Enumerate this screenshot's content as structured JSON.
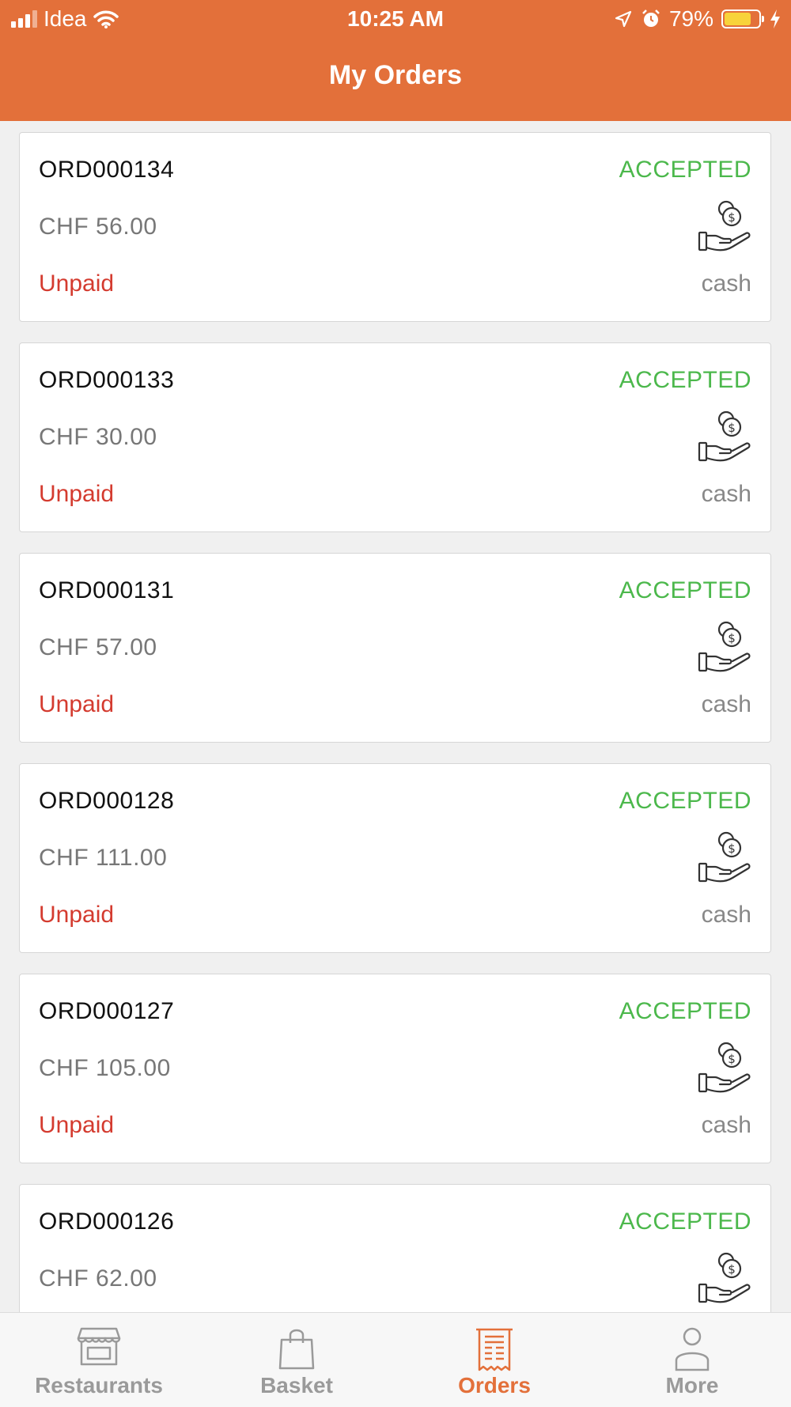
{
  "status_bar": {
    "carrier": "Idea",
    "time": "10:25 AM",
    "battery": "79%",
    "battery_level": 0.79
  },
  "header": {
    "title": "My Orders"
  },
  "orders": [
    {
      "id": "ORD000134",
      "status": "ACCEPTED",
      "amount": "CHF 56.00",
      "payment_status": "Unpaid",
      "payment_method": "cash"
    },
    {
      "id": "ORD000133",
      "status": "ACCEPTED",
      "amount": "CHF 30.00",
      "payment_status": "Unpaid",
      "payment_method": "cash"
    },
    {
      "id": "ORD000131",
      "status": "ACCEPTED",
      "amount": "CHF 57.00",
      "payment_status": "Unpaid",
      "payment_method": "cash"
    },
    {
      "id": "ORD000128",
      "status": "ACCEPTED",
      "amount": "CHF 111.00",
      "payment_status": "Unpaid",
      "payment_method": "cash"
    },
    {
      "id": "ORD000127",
      "status": "ACCEPTED",
      "amount": "CHF 105.00",
      "payment_status": "Unpaid",
      "payment_method": "cash"
    },
    {
      "id": "ORD000126",
      "status": "ACCEPTED",
      "amount": "CHF 62.00",
      "payment_status": "",
      "payment_method": ""
    }
  ],
  "tabbar": {
    "tabs": [
      {
        "label": "Restaurants",
        "icon": "storefront-icon"
      },
      {
        "label": "Basket",
        "icon": "shopping-bag-icon"
      },
      {
        "label": "Orders",
        "icon": "receipt-icon",
        "active": true
      },
      {
        "label": "More",
        "icon": "person-icon"
      }
    ]
  },
  "colors": {
    "accent": "#e3703a",
    "accepted": "#4cb84c",
    "unpaid": "#d43b2f"
  }
}
